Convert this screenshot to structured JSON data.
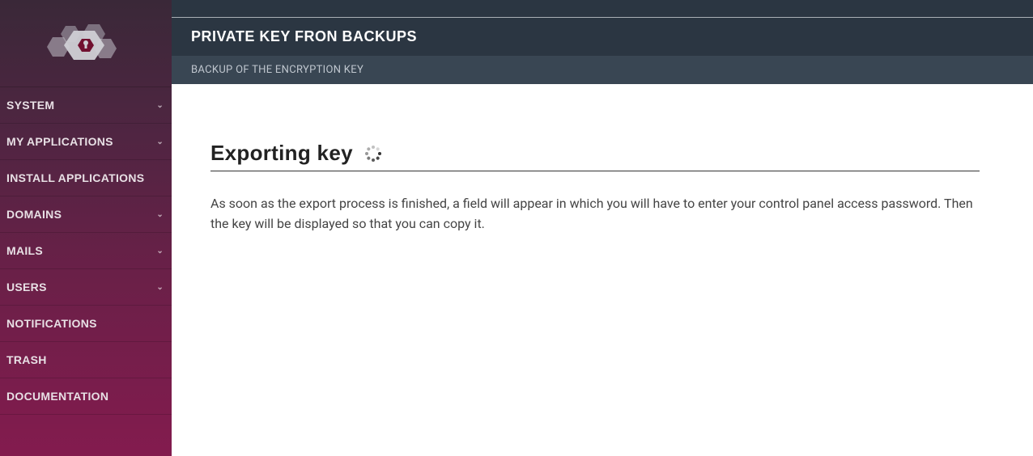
{
  "sidebar": {
    "items": [
      {
        "label": "SYSTEM",
        "expandable": true
      },
      {
        "label": "MY APPLICATIONS",
        "expandable": true
      },
      {
        "label": "INSTALL APPLICATIONS",
        "expandable": false
      },
      {
        "label": "DOMAINS",
        "expandable": true
      },
      {
        "label": "MAILS",
        "expandable": true
      },
      {
        "label": "USERS",
        "expandable": true
      },
      {
        "label": "NOTIFICATIONS",
        "expandable": false
      },
      {
        "label": "TRASH",
        "expandable": false
      },
      {
        "label": "DOCUMENTATION",
        "expandable": false
      }
    ]
  },
  "header": {
    "title": "PRIVATE KEY FRON BACKUPS",
    "subtitle": "BACKUP OF THE ENCRYPTION KEY"
  },
  "content": {
    "heading": "Exporting key",
    "body": "As soon as the export process is finished, a field will appear in which you will have to enter your control panel access password. Then the key will be displayed so that you can copy it."
  }
}
